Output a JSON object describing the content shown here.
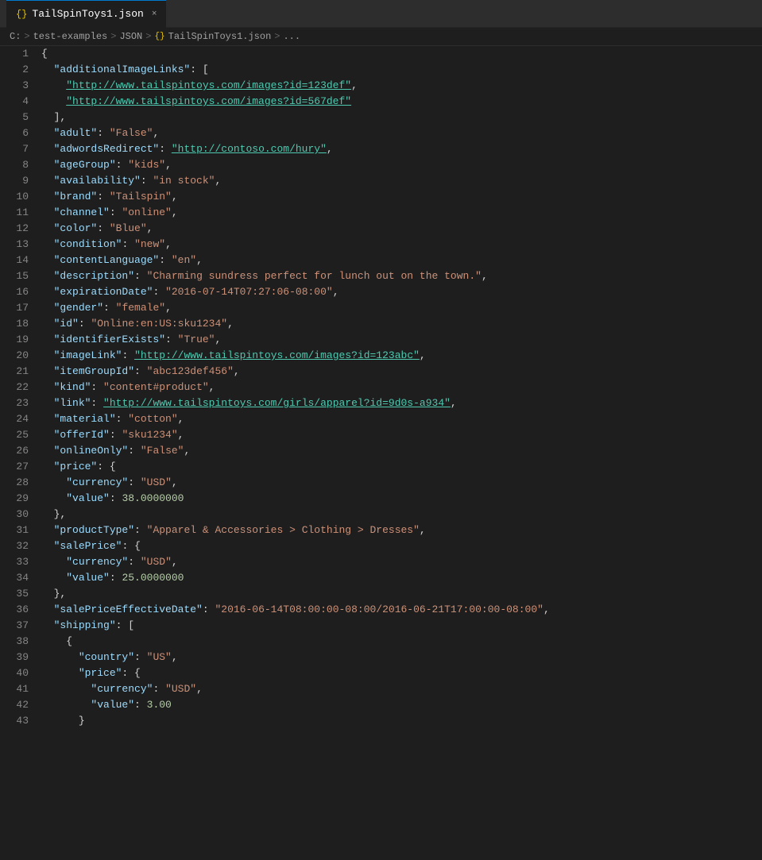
{
  "tab": {
    "icon": "{}",
    "label": "TailSpinToys1.json",
    "close": "×"
  },
  "breadcrumb": {
    "parts": [
      "C:",
      "test-examples",
      "JSON",
      "TailSpinToys1.json",
      "..."
    ],
    "separators": [
      ">",
      ">",
      ">",
      ">"
    ]
  },
  "lines": [
    {
      "num": 1,
      "content": "{"
    },
    {
      "num": 2,
      "content": "  \"additionalImageLinks\": ["
    },
    {
      "num": 3,
      "content": "    \"http://www.tailspintoys.com/images?id=123def\","
    },
    {
      "num": 4,
      "content": "    \"http://www.tailspintoys.com/images?id=567def\""
    },
    {
      "num": 5,
      "content": "  ],"
    },
    {
      "num": 6,
      "content": "  \"adult\": \"False\","
    },
    {
      "num": 7,
      "content": "  \"adwordsRedirect\": \"http://contoso.com/hury\","
    },
    {
      "num": 8,
      "content": "  \"ageGroup\": \"kids\","
    },
    {
      "num": 9,
      "content": "  \"availability\": \"in stock\","
    },
    {
      "num": 10,
      "content": "  \"brand\": \"Tailspin\","
    },
    {
      "num": 11,
      "content": "  \"channel\": \"online\","
    },
    {
      "num": 12,
      "content": "  \"color\": \"Blue\","
    },
    {
      "num": 13,
      "content": "  \"condition\": \"new\","
    },
    {
      "num": 14,
      "content": "  \"contentLanguage\": \"en\","
    },
    {
      "num": 15,
      "content": "  \"description\": \"Charming sundress perfect for lunch out on the town.\","
    },
    {
      "num": 16,
      "content": "  \"expirationDate\": \"2016-07-14T07:27:06-08:00\","
    },
    {
      "num": 17,
      "content": "  \"gender\": \"female\","
    },
    {
      "num": 18,
      "content": "  \"id\": \"Online:en:US:sku1234\","
    },
    {
      "num": 19,
      "content": "  \"identifierExists\": \"True\","
    },
    {
      "num": 20,
      "content": "  \"imageLink\": \"http://www.tailspintoys.com/images?id=123abc\","
    },
    {
      "num": 21,
      "content": "  \"itemGroupId\": \"abc123def456\","
    },
    {
      "num": 22,
      "content": "  \"kind\": \"content#product\","
    },
    {
      "num": 23,
      "content": "  \"link\": \"http://www.tailspintoys.com/girls/apparel?id=9d0s-a934\","
    },
    {
      "num": 24,
      "content": "  \"material\": \"cotton\","
    },
    {
      "num": 25,
      "content": "  \"offerId\": \"sku1234\","
    },
    {
      "num": 26,
      "content": "  \"onlineOnly\": \"False\","
    },
    {
      "num": 27,
      "content": "  \"price\": {"
    },
    {
      "num": 28,
      "content": "    \"currency\": \"USD\","
    },
    {
      "num": 29,
      "content": "    \"value\": 38.0000000"
    },
    {
      "num": 30,
      "content": "  },"
    },
    {
      "num": 31,
      "content": "  \"productType\": \"Apparel & Accessories > Clothing > Dresses\","
    },
    {
      "num": 32,
      "content": "  \"salePrice\": {"
    },
    {
      "num": 33,
      "content": "    \"currency\": \"USD\","
    },
    {
      "num": 34,
      "content": "    \"value\": 25.0000000"
    },
    {
      "num": 35,
      "content": "  },"
    },
    {
      "num": 36,
      "content": "  \"salePriceEffectiveDate\": \"2016-06-14T08:00:00-08:00/2016-06-21T17:00:00-08:00\","
    },
    {
      "num": 37,
      "content": "  \"shipping\": ["
    },
    {
      "num": 38,
      "content": "    {"
    },
    {
      "num": 39,
      "content": "      \"country\": \"US\","
    },
    {
      "num": 40,
      "content": "      \"price\": {"
    },
    {
      "num": 41,
      "content": "        \"currency\": \"USD\","
    },
    {
      "num": 42,
      "content": "        \"value\": 3.00"
    },
    {
      "num": 43,
      "content": "      }"
    }
  ]
}
